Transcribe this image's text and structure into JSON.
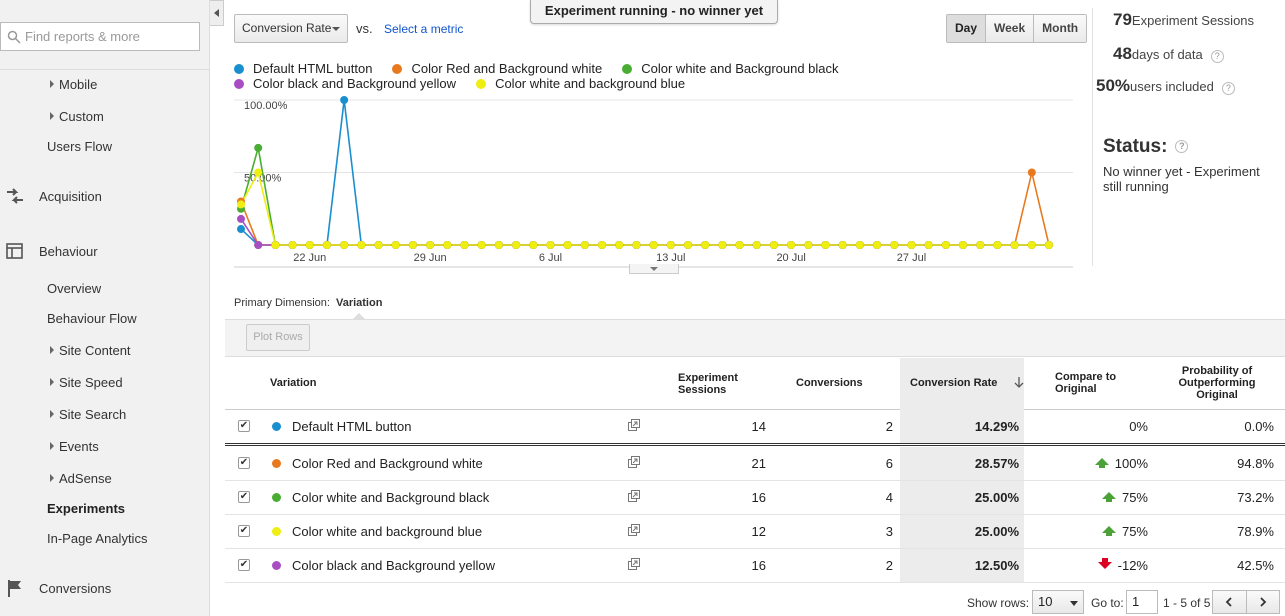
{
  "sidebar": {
    "search_placeholder": "Find reports & more",
    "items": [
      {
        "label": "Mobile"
      },
      {
        "label": "Custom"
      },
      {
        "label": "Users Flow"
      }
    ],
    "acquisition": "Acquisition",
    "behaviour": "Behaviour",
    "behaviour_items": [
      {
        "label": "Overview"
      },
      {
        "label": "Behaviour Flow"
      },
      {
        "label": "Site Content"
      },
      {
        "label": "Site Speed"
      },
      {
        "label": "Site Search"
      },
      {
        "label": "Events"
      },
      {
        "label": "AdSense"
      },
      {
        "label": "Experiments"
      },
      {
        "label": "In-Page Analytics"
      }
    ],
    "conversions": "Conversions"
  },
  "banner": "Experiment running - no winner yet",
  "controls": {
    "metric": "Conversion Rate",
    "vs": "vs.",
    "select_metric": "Select a metric",
    "periods": [
      "Day",
      "Week",
      "Month"
    ],
    "active_period": "Day"
  },
  "stats": {
    "sessions_num": "79",
    "sessions_lbl": "Experiment Sessions",
    "days_num": "48",
    "days_lbl": "days of data",
    "users_num": "50%",
    "users_lbl": "users included",
    "help": "?",
    "status_title": "Status:",
    "status_text": "No winner yet - Experiment still running"
  },
  "colors": {
    "blue": "#1a8fcf",
    "orange": "#e8791e",
    "green": "#4aad33",
    "purple": "#a94ec2",
    "yellow": "#eeee11"
  },
  "chart_data": {
    "type": "line",
    "x": [
      "18 Jun",
      "19 Jun",
      "20 Jun",
      "21 Jun",
      "22 Jun",
      "23 Jun",
      "24 Jun",
      "25 Jun",
      "26 Jun",
      "27 Jun",
      "28 Jun",
      "29 Jun",
      "30 Jun",
      "1 Jul",
      "2 Jul",
      "3 Jul",
      "4 Jul",
      "5 Jul",
      "6 Jul",
      "7 Jul",
      "8 Jul",
      "9 Jul",
      "10 Jul",
      "11 Jul",
      "12 Jul",
      "13 Jul",
      "14 Jul",
      "15 Jul",
      "16 Jul",
      "17 Jul",
      "18 Jul",
      "19 Jul",
      "20 Jul",
      "21 Jul",
      "22 Jul",
      "23 Jul",
      "24 Jul",
      "25 Jul",
      "26 Jul",
      "27 Jul",
      "28 Jul",
      "29 Jul",
      "30 Jul",
      "31 Jul",
      "1 Aug",
      "2 Aug",
      "3 Aug",
      "4 Aug"
    ],
    "x_ticks": [
      "22 Jun",
      "29 Jun",
      "6 Jul",
      "13 Jul",
      "20 Jul",
      "27 Jul"
    ],
    "y_ticks": [
      "100.00%",
      "50.00%"
    ],
    "ylim": [
      0,
      100
    ],
    "series": [
      {
        "name": "Default HTML button",
        "color": "#1a8fcf",
        "values": [
          11,
          0,
          0,
          0,
          0,
          0,
          100,
          0,
          0,
          0,
          0,
          0,
          0,
          0,
          0,
          0,
          0,
          0,
          0,
          0,
          0,
          0,
          0,
          0,
          0,
          0,
          0,
          0,
          0,
          0,
          0,
          0,
          0,
          0,
          0,
          0,
          0,
          0,
          0,
          0,
          0,
          0,
          0,
          0,
          0,
          0,
          0,
          0
        ]
      },
      {
        "name": "Color Red and Background white",
        "color": "#e8791e",
        "values": [
          30,
          0,
          0,
          0,
          0,
          0,
          0,
          0,
          0,
          0,
          0,
          0,
          0,
          0,
          0,
          0,
          0,
          0,
          0,
          0,
          0,
          0,
          0,
          0,
          0,
          0,
          0,
          0,
          0,
          0,
          0,
          0,
          0,
          0,
          0,
          0,
          0,
          0,
          0,
          0,
          0,
          0,
          0,
          0,
          0,
          0,
          50,
          0
        ]
      },
      {
        "name": "Color white and Background black",
        "color": "#4aad33",
        "values": [
          25,
          67,
          0,
          0,
          0,
          0,
          0,
          0,
          0,
          0,
          0,
          0,
          0,
          0,
          0,
          0,
          0,
          0,
          0,
          0,
          0,
          0,
          0,
          0,
          0,
          0,
          0,
          0,
          0,
          0,
          0,
          0,
          0,
          0,
          0,
          0,
          0,
          0,
          0,
          0,
          0,
          0,
          0,
          0,
          0,
          0,
          0,
          0
        ]
      },
      {
        "name": "Color black and Background yellow",
        "color": "#a94ec2",
        "values": [
          18,
          0,
          0,
          0,
          0,
          0,
          0,
          0,
          0,
          0,
          0,
          0,
          0,
          0,
          0,
          0,
          0,
          0,
          0,
          0,
          0,
          0,
          0,
          0,
          0,
          0,
          0,
          0,
          0,
          0,
          0,
          0,
          0,
          0,
          0,
          0,
          0,
          0,
          0,
          0,
          0,
          0,
          0,
          0,
          0,
          0,
          0,
          0
        ]
      },
      {
        "name": "Color white and background blue",
        "color": "#eeee11",
        "values": [
          28,
          50,
          0,
          0,
          0,
          0,
          0,
          0,
          0,
          0,
          0,
          0,
          0,
          0,
          0,
          0,
          0,
          0,
          0,
          0,
          0,
          0,
          0,
          0,
          0,
          0,
          0,
          0,
          0,
          0,
          0,
          0,
          0,
          0,
          0,
          0,
          0,
          0,
          0,
          0,
          0,
          0,
          0,
          0,
          0,
          0,
          0,
          0
        ]
      }
    ]
  },
  "primary_dimension": {
    "label": "Primary Dimension:",
    "value": "Variation"
  },
  "plot_rows": "Plot Rows",
  "table": {
    "headers": {
      "variation": "Variation",
      "sessions": "Experiment Sessions",
      "conversions": "Conversions",
      "rate": "Conversion Rate",
      "compare": "Compare to Original",
      "prob": "Probability of Outperforming Original"
    },
    "rows": [
      {
        "name": "Default HTML button",
        "color": "#1a8fcf",
        "sessions": "14",
        "conversions": "2",
        "rate": "14.29%",
        "compare": "0%",
        "trend": "none",
        "prob": "0.0%"
      },
      {
        "name": "Color Red and Background white",
        "color": "#e8791e",
        "sessions": "21",
        "conversions": "6",
        "rate": "28.57%",
        "compare": "100%",
        "trend": "up",
        "prob": "94.8%"
      },
      {
        "name": "Color white and Background black",
        "color": "#4aad33",
        "sessions": "16",
        "conversions": "4",
        "rate": "25.00%",
        "compare": "75%",
        "trend": "up",
        "prob": "73.2%"
      },
      {
        "name": "Color white and background blue",
        "color": "#eeee11",
        "sessions": "12",
        "conversions": "3",
        "rate": "25.00%",
        "compare": "75%",
        "trend": "up",
        "prob": "78.9%"
      },
      {
        "name": "Color black and Background yellow",
        "color": "#a94ec2",
        "sessions": "16",
        "conversions": "2",
        "rate": "12.50%",
        "compare": "-12%",
        "trend": "down",
        "prob": "42.5%"
      }
    ]
  },
  "footer": {
    "show_rows": "Show rows:",
    "rows_value": "10",
    "goto": "Go to:",
    "goto_value": "1",
    "range": "1 - 5 of 5"
  }
}
